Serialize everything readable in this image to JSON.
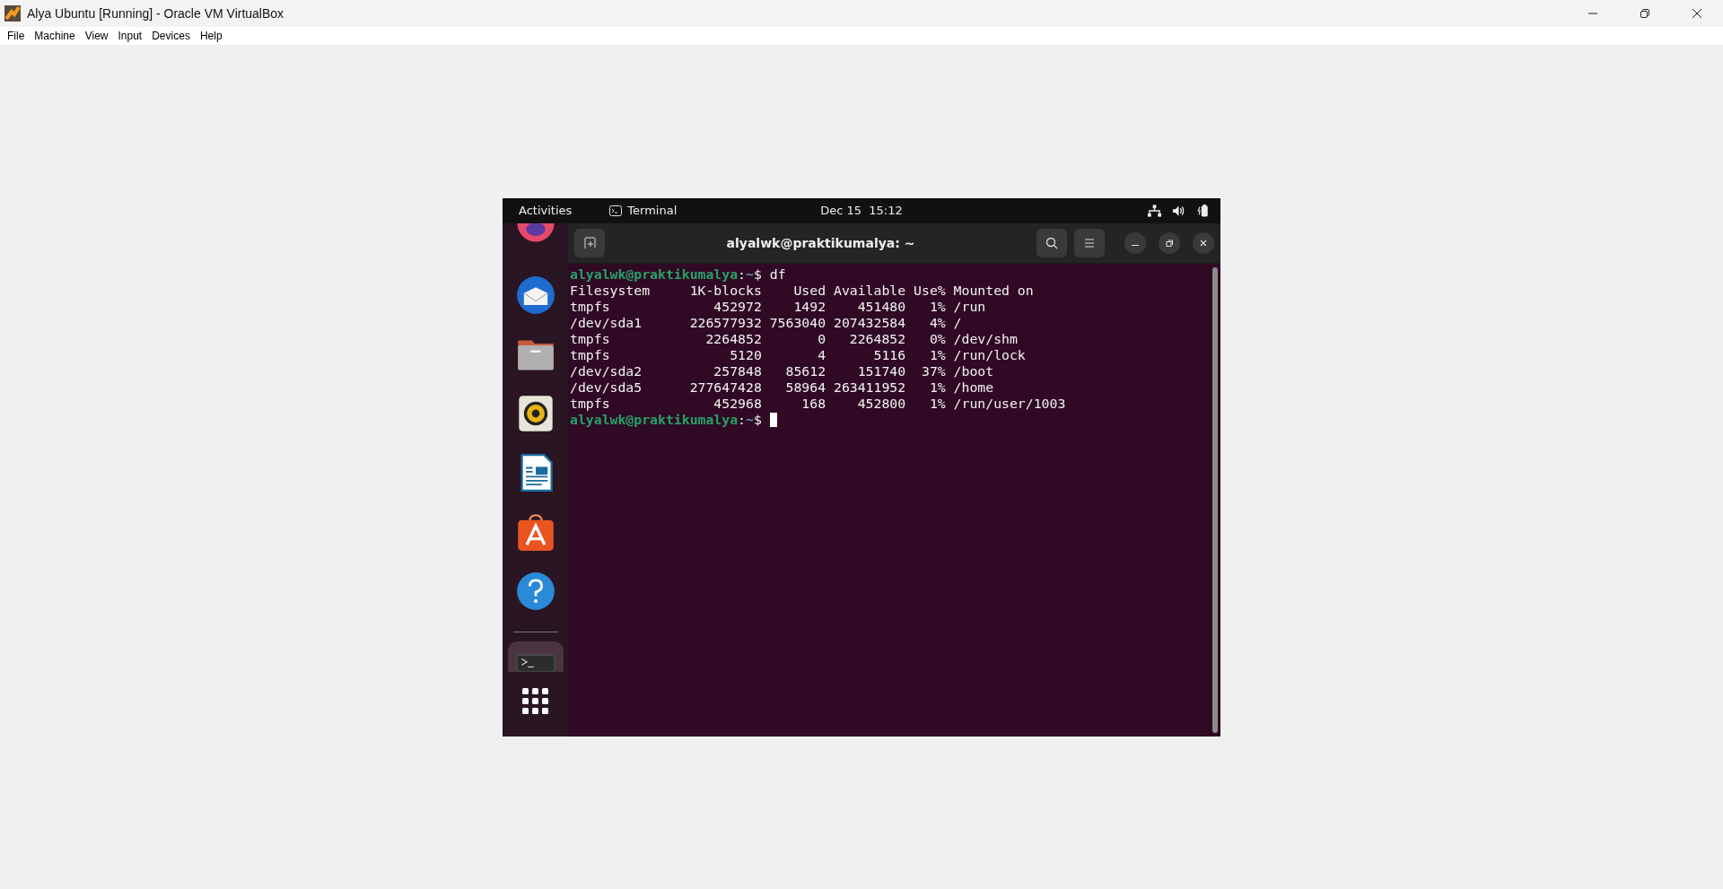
{
  "window": {
    "title": "Alya Ubuntu [Running] - Oracle VM VirtualBox"
  },
  "menu": [
    "File",
    "Machine",
    "View",
    "Input",
    "Devices",
    "Help"
  ],
  "top_panel": {
    "activities": "Activities",
    "app": "Terminal",
    "clock": "Dec 15  15:12"
  },
  "dock": [
    {
      "kind": "browser",
      "active": false
    },
    {
      "kind": "mail",
      "active": false
    },
    {
      "kind": "files",
      "active": false
    },
    {
      "kind": "music",
      "active": false
    },
    {
      "kind": "writer",
      "active": false
    },
    {
      "kind": "software",
      "active": false
    },
    {
      "kind": "help",
      "active": false
    },
    {
      "kind": "separator"
    },
    {
      "kind": "terminal",
      "active": true
    },
    {
      "kind": "grid",
      "active": false
    }
  ],
  "terminal": {
    "title": "alyalwk@praktikumalya: ~",
    "prompts": [
      {
        "user_host": "alyalwk@praktikumalya",
        "separator": ":",
        "path": "~",
        "symbol": "$",
        "command": "df"
      },
      {
        "user_host": "alyalwk@praktikumalya",
        "separator": ":",
        "path": "~",
        "symbol": "$"
      }
    ],
    "header": [
      "Filesystem",
      "1K-blocks",
      "Used",
      "Available",
      "Use%",
      "Mounted on"
    ],
    "rows": [
      {
        "filesystem": "tmpfs",
        "blocks": "452972",
        "used": "1492",
        "available": "451480",
        "use": "1%",
        "mounted": "/run"
      },
      {
        "filesystem": "/dev/sda1",
        "blocks": "226577932",
        "used": "7563040",
        "available": "207432584",
        "use": "4%",
        "mounted": "/"
      },
      {
        "filesystem": "tmpfs",
        "blocks": "2264852",
        "used": "0",
        "available": "2264852",
        "use": "0%",
        "mounted": "/dev/shm"
      },
      {
        "filesystem": "tmpfs",
        "blocks": "5120",
        "used": "4",
        "available": "5116",
        "use": "1%",
        "mounted": "/run/lock"
      },
      {
        "filesystem": "/dev/sda2",
        "blocks": "257848",
        "used": "85612",
        "available": "151740",
        "use": "37%",
        "mounted": "/boot"
      },
      {
        "filesystem": "/dev/sda5",
        "blocks": "277647428",
        "used": "58964",
        "available": "263411952",
        "use": "1%",
        "mounted": "/home"
      },
      {
        "filesystem": "tmpfs",
        "blocks": "452968",
        "used": "168",
        "available": "452800",
        "use": "1%",
        "mounted": "/run/user/1003"
      }
    ]
  }
}
